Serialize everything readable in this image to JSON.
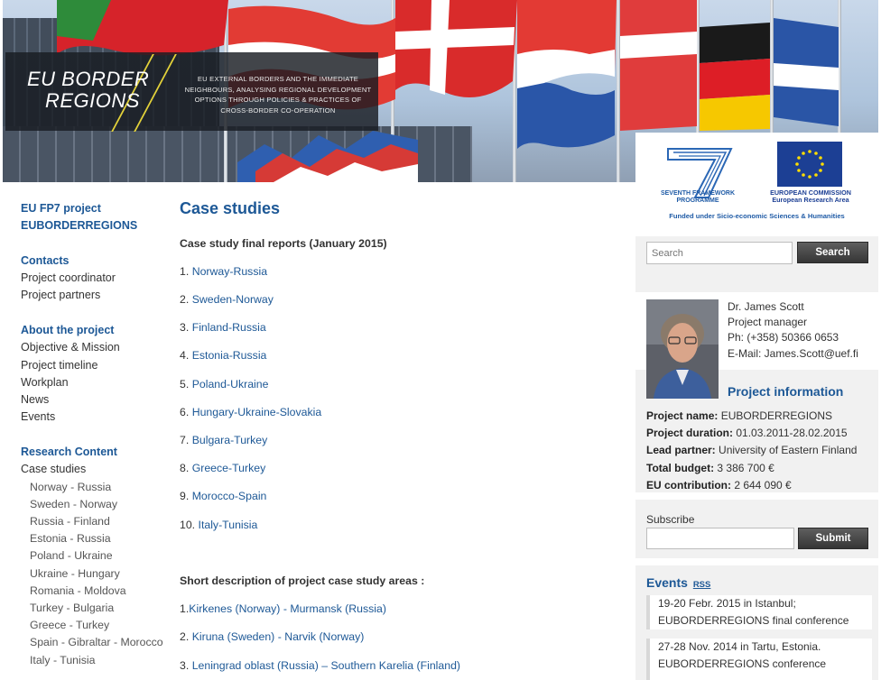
{
  "banner": {
    "logo_line1": "EU BORDER",
    "logo_line2": "REGIONS",
    "tagline": "EU EXTERNAL BORDERS AND THE IMMEDIATE NEIGHBOURS, ANALYSING REGIONAL DEVELOPMENT OPTIONS THROUGH POLICIES & PRACTICES OF CROSS-BORDER CO-OPERATION"
  },
  "funding": {
    "fp7_label": "SEVENTH FRAMEWORK PROGRAMME",
    "ec_label_1": "EUROPEAN COMMISSION",
    "ec_label_2": "European Research Area",
    "funded_text": "Funded under Sicio-economic Sciences & Humanities"
  },
  "nav": {
    "project_title_1": "EU FP7 project",
    "project_title_2": "EUBORDERREGIONS",
    "contacts_head": "Contacts",
    "contacts": [
      "Project coordinator",
      "Project partners"
    ],
    "about_head": "About the project",
    "about": [
      "Objective & Mission",
      "Project timeline",
      "Workplan",
      "News",
      "Events"
    ],
    "research_head": "Research Content",
    "research_item": "Case studies",
    "case_studies": [
      "Norway - Russia",
      "Sweden - Norway",
      "Russia - Finland",
      "Estonia - Russia",
      "Poland - Ukraine",
      "Ukraine - Hungary",
      "Romania - Moldova",
      "Turkey - Bulgaria",
      "Greece - Turkey",
      "Spain - Gibraltar - Morocco",
      "Italy - Tunisia"
    ]
  },
  "main": {
    "title": "Case studies",
    "reports_heading": "Case study final reports (January 2015)",
    "reports": [
      {
        "num": "1.",
        "label": "Norway-Russia"
      },
      {
        "num": "2.",
        "label": "Sweden-Norway"
      },
      {
        "num": "3.",
        "label": "Finland-Russia"
      },
      {
        "num": "4.",
        "label": "Estonia-Russia"
      },
      {
        "num": "5.",
        "label": "Poland-Ukraine"
      },
      {
        "num": "6.",
        "label": "Hungary-Ukraine-Slovakia"
      },
      {
        "num": "7.",
        "label": "Bulgara-Turkey"
      },
      {
        "num": "8.",
        "label": "Greece-Turkey"
      },
      {
        "num": "9.",
        "label": "Morocco-Spain"
      },
      {
        "num": "10.",
        "label": "Italy-Tunisia"
      }
    ],
    "areas_heading": "Short description of project case study areas :",
    "areas": [
      {
        "num": "1.",
        "label": "Kirkenes (Norway) - Murmansk (Russia)"
      },
      {
        "num": "2.",
        "label": "Kiruna (Sweden) - Narvik (Norway)"
      },
      {
        "num": "3.",
        "label": "Leningrad oblast (Russia) – Southern Karelia (Finland)"
      }
    ]
  },
  "sidebar": {
    "search_placeholder": "Search",
    "search_button": "Search",
    "contact": {
      "name": "Dr. James Scott",
      "role": "Project manager",
      "phone": "Ph: (+358) 50366 0653",
      "email": "E-Mail: James.Scott@uef.fi"
    },
    "info_title": "Project information",
    "info": [
      {
        "label": "Project name:",
        "value": " EUBORDERREGIONS"
      },
      {
        "label": "Project duration:",
        "value": " 01.03.2011-28.02.2015"
      },
      {
        "label": "Lead partner:",
        "value": " University of Eastern Finland"
      },
      {
        "label": "Total budget:",
        "value": " 3 386 700 €"
      },
      {
        "label": "EU contribution:",
        "value": " 2 644 090 €"
      }
    ],
    "subscribe_label": "Subscribe",
    "subscribe_button": "Submit",
    "events_title": "Events",
    "rss_label": "RSS",
    "events": [
      {
        "line1": "19-20 Febr. 2015 in Istanbul;",
        "line2": "EUBORDERREGIONS final conference"
      },
      {
        "line1": "27-28 Nov. 2014 in Tartu, Estonia.",
        "line2": "EUBORDERREGIONS conference"
      }
    ]
  },
  "colors": {
    "link_blue": "#1d5896",
    "sidebar_bg": "#f1f1f1",
    "button_dark": "#404040",
    "logo_accent": "#e3d23a"
  }
}
